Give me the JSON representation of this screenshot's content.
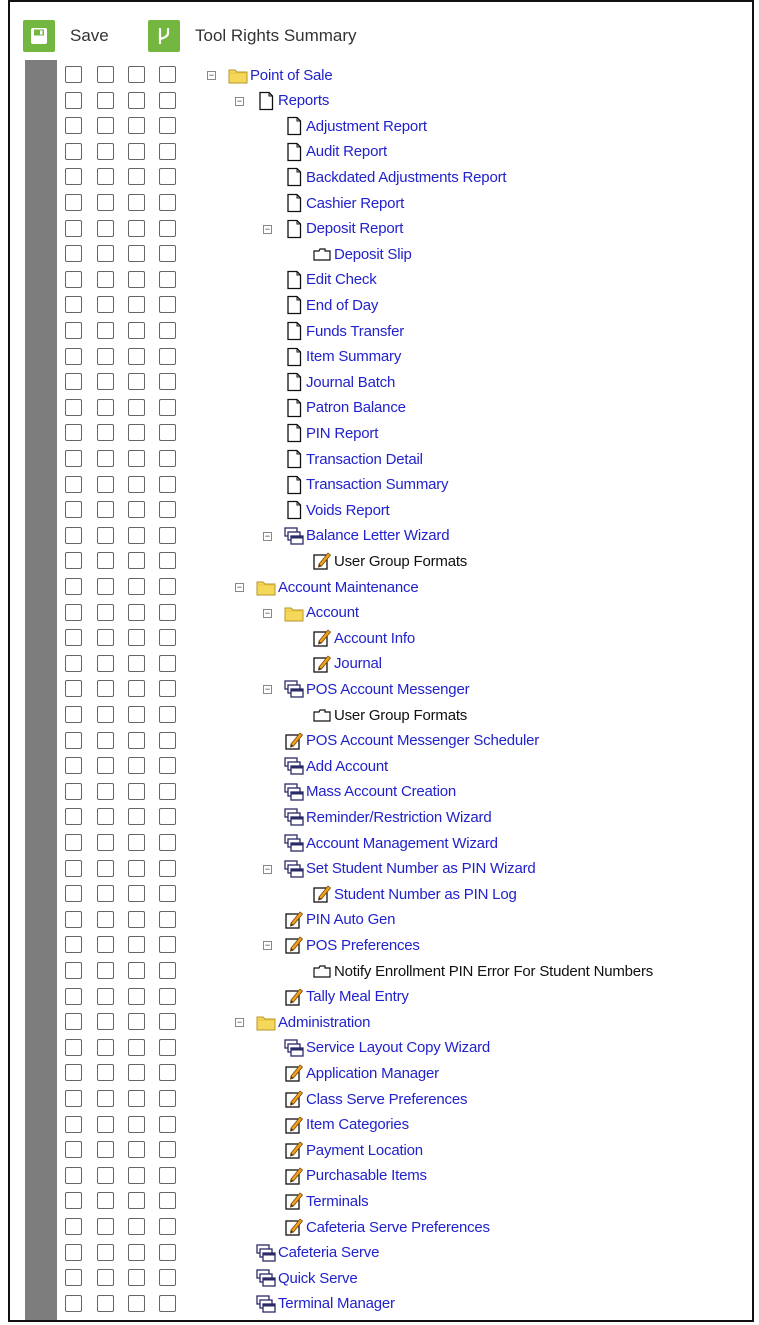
{
  "toolbar": {
    "save_label": "Save",
    "tool_rights_label": "Tool Rights Summary",
    "accent_color": "#74b740"
  },
  "tree": [
    {
      "label": "Point of Sale",
      "icon": "folder",
      "depth": 0,
      "toggle": true,
      "link": true
    },
    {
      "label": "Reports",
      "icon": "document",
      "depth": 1,
      "toggle": true,
      "link": true
    },
    {
      "label": "Adjustment Report",
      "icon": "document",
      "depth": 2,
      "link": true
    },
    {
      "label": "Audit Report",
      "icon": "document",
      "depth": 2,
      "link": true
    },
    {
      "label": "Backdated Adjustments Report",
      "icon": "document",
      "depth": 2,
      "link": true
    },
    {
      "label": "Cashier Report",
      "icon": "document",
      "depth": 2,
      "link": true
    },
    {
      "label": "Deposit Report",
      "icon": "document",
      "depth": 2,
      "toggle": true,
      "link": true
    },
    {
      "label": "Deposit Slip",
      "icon": "subtab",
      "depth": 3,
      "link": true
    },
    {
      "label": "Edit Check",
      "icon": "document",
      "depth": 2,
      "link": true
    },
    {
      "label": "End of Day",
      "icon": "document",
      "depth": 2,
      "link": true
    },
    {
      "label": "Funds Transfer",
      "icon": "document",
      "depth": 2,
      "link": true
    },
    {
      "label": "Item Summary",
      "icon": "document",
      "depth": 2,
      "link": true
    },
    {
      "label": "Journal Batch",
      "icon": "document",
      "depth": 2,
      "link": true
    },
    {
      "label": "Patron Balance",
      "icon": "document",
      "depth": 2,
      "link": true
    },
    {
      "label": "PIN Report",
      "icon": "document",
      "depth": 2,
      "link": true
    },
    {
      "label": "Transaction Detail",
      "icon": "document",
      "depth": 2,
      "link": true
    },
    {
      "label": "Transaction Summary",
      "icon": "document",
      "depth": 2,
      "link": true
    },
    {
      "label": "Voids Report",
      "icon": "document",
      "depth": 2,
      "link": true
    },
    {
      "label": "Balance Letter Wizard",
      "icon": "wizard",
      "depth": 2,
      "toggle": true,
      "link": true
    },
    {
      "label": "User Group Formats",
      "icon": "editor",
      "depth": 3,
      "link": false
    },
    {
      "label": "Account Maintenance",
      "icon": "folder",
      "depth": 1,
      "toggle": true,
      "link": true
    },
    {
      "label": "Account",
      "icon": "folder",
      "depth": 2,
      "toggle": true,
      "link": true
    },
    {
      "label": "Account Info",
      "icon": "editor",
      "depth": 3,
      "link": true
    },
    {
      "label": "Journal",
      "icon": "editor",
      "depth": 3,
      "link": true
    },
    {
      "label": "POS Account Messenger",
      "icon": "wizard",
      "depth": 2,
      "toggle": true,
      "link": true
    },
    {
      "label": "User Group Formats",
      "icon": "subtab",
      "depth": 3,
      "link": false
    },
    {
      "label": "POS Account Messenger Scheduler",
      "icon": "editor",
      "depth": 2,
      "link": true
    },
    {
      "label": "Add Account",
      "icon": "wizard",
      "depth": 2,
      "link": true
    },
    {
      "label": "Mass Account Creation",
      "icon": "wizard",
      "depth": 2,
      "link": true
    },
    {
      "label": "Reminder/Restriction Wizard",
      "icon": "wizard",
      "depth": 2,
      "link": true
    },
    {
      "label": "Account Management Wizard",
      "icon": "wizard",
      "depth": 2,
      "link": true
    },
    {
      "label": "Set Student Number as PIN Wizard",
      "icon": "wizard",
      "depth": 2,
      "toggle": true,
      "link": true
    },
    {
      "label": "Student Number as PIN Log",
      "icon": "editor",
      "depth": 3,
      "link": true
    },
    {
      "label": "PIN Auto Gen",
      "icon": "editor",
      "depth": 2,
      "link": true
    },
    {
      "label": "POS Preferences",
      "icon": "editor",
      "depth": 2,
      "toggle": true,
      "link": true
    },
    {
      "label": "Notify Enrollment PIN Error For Student Numbers",
      "icon": "subtab",
      "depth": 3,
      "link": false
    },
    {
      "label": "Tally Meal Entry",
      "icon": "editor",
      "depth": 2,
      "link": true
    },
    {
      "label": "Administration",
      "icon": "folder",
      "depth": 1,
      "toggle": true,
      "link": true
    },
    {
      "label": "Service Layout Copy Wizard",
      "icon": "wizard",
      "depth": 2,
      "link": true
    },
    {
      "label": "Application Manager",
      "icon": "editor",
      "depth": 2,
      "link": true
    },
    {
      "label": "Class Serve Preferences",
      "icon": "editor",
      "depth": 2,
      "link": true
    },
    {
      "label": "Item Categories",
      "icon": "editor",
      "depth": 2,
      "link": true
    },
    {
      "label": "Payment Location",
      "icon": "editor",
      "depth": 2,
      "link": true
    },
    {
      "label": "Purchasable Items",
      "icon": "editor",
      "depth": 2,
      "link": true
    },
    {
      "label": "Terminals",
      "icon": "editor",
      "depth": 2,
      "link": true
    },
    {
      "label": "Cafeteria Serve Preferences",
      "icon": "editor",
      "depth": 2,
      "link": true
    },
    {
      "label": "Cafeteria Serve",
      "icon": "wizard",
      "depth": 1,
      "link": true
    },
    {
      "label": "Quick Serve",
      "icon": "wizard",
      "depth": 1,
      "link": true
    },
    {
      "label": "Terminal Manager",
      "icon": "wizard",
      "depth": 1,
      "link": true
    }
  ]
}
